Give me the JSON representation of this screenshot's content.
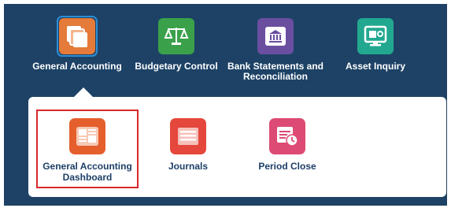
{
  "top_nav": [
    {
      "label": "General Accounting",
      "icon": "stacked-pages-icon",
      "color": "#e47b3a",
      "selected": true
    },
    {
      "label": "Budgetary Control",
      "icon": "balance-scale-icon",
      "color": "#3aa14a"
    },
    {
      "label": "Bank Statements and Reconciliation",
      "icon": "bank-icon",
      "color": "#6a4ea0"
    },
    {
      "label": "Asset Inquiry",
      "icon": "asset-screen-icon",
      "color": "#22a890"
    }
  ],
  "sub_nav": [
    {
      "label": "General Accounting Dashboard",
      "icon": "dashboard-icon",
      "color": "#e55f2d",
      "highlighted": true
    },
    {
      "label": "Journals",
      "icon": "journal-list-icon",
      "color": "#e5473c"
    },
    {
      "label": "Period Close",
      "icon": "calendar-clock-icon",
      "color": "#dd4a73"
    }
  ],
  "colors": {
    "background": "#1d4266",
    "highlight_border": "#d8282a",
    "sub_label": "#1c3f67"
  }
}
